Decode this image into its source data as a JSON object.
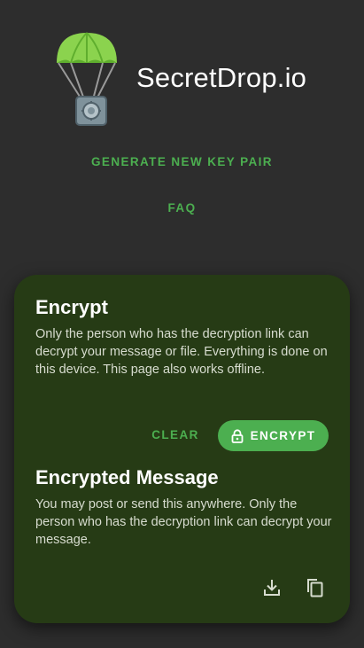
{
  "header": {
    "logo_icon": "parachute-safe-icon",
    "title": "SecretDrop.io"
  },
  "nav": {
    "generate_key_pair": "GENERATE NEW KEY PAIR",
    "faq": "FAQ"
  },
  "encrypt_section": {
    "title": "Encrypt",
    "description": "Only the person who has the decryption link can decrypt your message or file. Everything is done on this device. This page also works offline.",
    "clear_label": "CLEAR",
    "encrypt_label": "ENCRYPT",
    "encrypt_icon": "lock-icon"
  },
  "encrypted_section": {
    "title": "Encrypted Message",
    "description": "You may post or send this anywhere. Only the person who has the decryption link can decrypt your message.",
    "download_icon": "download-icon",
    "copy_icon": "copy-icon"
  },
  "colors": {
    "background": "#2d2d2d",
    "accent": "#4caf50",
    "card": "#263b15"
  }
}
